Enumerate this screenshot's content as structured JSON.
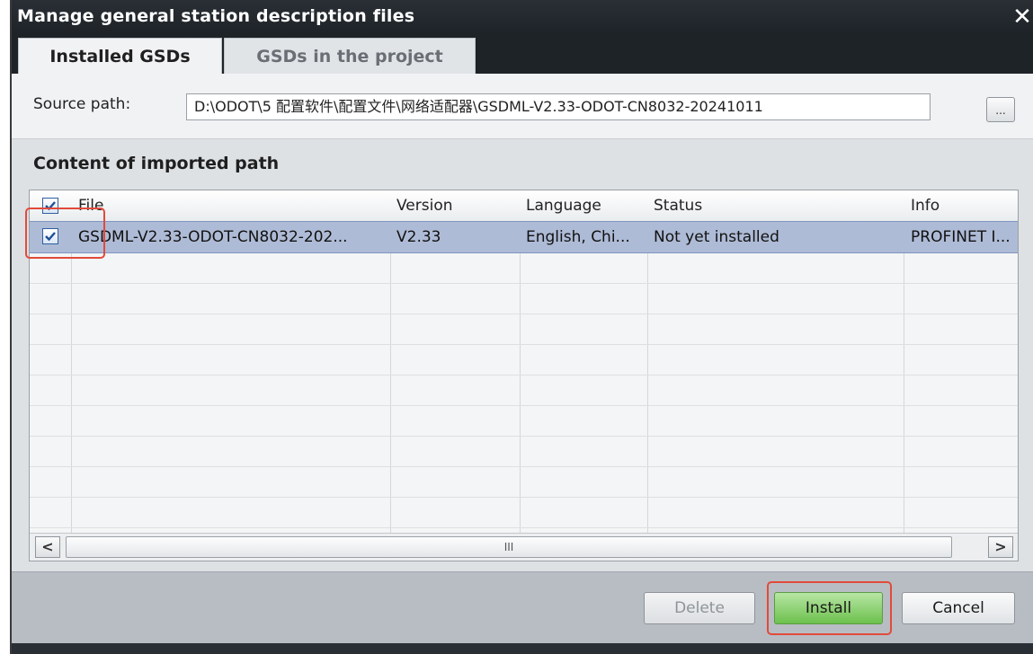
{
  "window": {
    "title": "Manage general station description files",
    "close_glyph": "✕"
  },
  "tabs": [
    {
      "label": "Installed GSDs",
      "active": true
    },
    {
      "label": "GSDs in the project",
      "active": false
    }
  ],
  "source": {
    "label": "Source path:",
    "value": "D:\\ODOT\\5 配置软件\\配置文件\\网络适配器\\GSDML-V2.33-ODOT-CN8032-20241011",
    "browse_label": "..."
  },
  "content": {
    "title": "Content of imported path",
    "columns": [
      "File",
      "Version",
      "Language",
      "Status",
      "Info"
    ],
    "header_checked": true,
    "rows": [
      {
        "checked": true,
        "file": "GSDML-V2.33-ODOT-CN8032-202...",
        "version": "V2.33",
        "language": "English, Chi...",
        "status": "Not yet installed",
        "info": "PROFINET I..."
      }
    ]
  },
  "scrollbar": {
    "left_glyph": "<",
    "right_glyph": ">",
    "thumb_glyph": "III"
  },
  "buttons": {
    "delete": "Delete",
    "install": "Install",
    "cancel": "Cancel"
  },
  "colors": {
    "titlebar": "#1e2328",
    "selected_row": "#aebbd6",
    "install_button": "#6cc04d",
    "highlight": "#e24a3b"
  },
  "icons": [
    "close-icon",
    "checkmark-icon",
    "scroll-left-icon",
    "scroll-right-icon"
  ]
}
